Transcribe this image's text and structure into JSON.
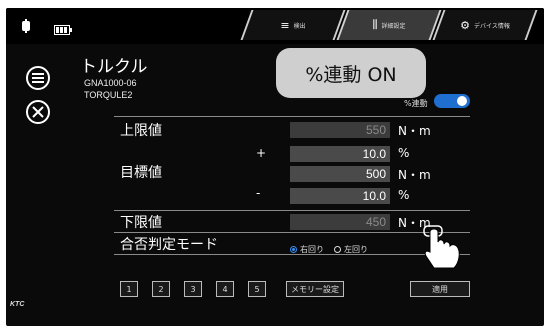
{
  "topbar": {
    "tabs": [
      {
        "label": "検出",
        "icon": "gauge-icon"
      },
      {
        "label": "詳細設定",
        "icon": "sliders-icon"
      },
      {
        "label": "デバイス情報",
        "icon": "device-icon"
      }
    ]
  },
  "header": {
    "title": "トルクル",
    "model": "GNA1000-06",
    "name": "TORQULE2"
  },
  "callout": "%連動 ON",
  "link_toggle": {
    "label": "%連動",
    "on": true
  },
  "rows": {
    "upper_label": "上限値",
    "upper_value": "550",
    "target_label": "目標値",
    "plus_sign": "+",
    "plus_value": "10.0",
    "target_value": "500",
    "minus_sign": "-",
    "minus_value": "10.0",
    "lower_label": "下限値",
    "lower_value": "450",
    "mode_label": "合否判定モード",
    "unit_nm": "N・m",
    "unit_pct": "%"
  },
  "radio": {
    "right": "右回り",
    "left": "左回り",
    "selected": "右回り"
  },
  "memory_buttons": [
    "1",
    "2",
    "3",
    "4",
    "5"
  ],
  "memory_set_label": "メモリー設定",
  "apply_label": "適用",
  "brand": "KTC",
  "colors": {
    "accent": "#1f6fd0",
    "background": "#0a0a0a",
    "callout": "#cfcfcf"
  }
}
